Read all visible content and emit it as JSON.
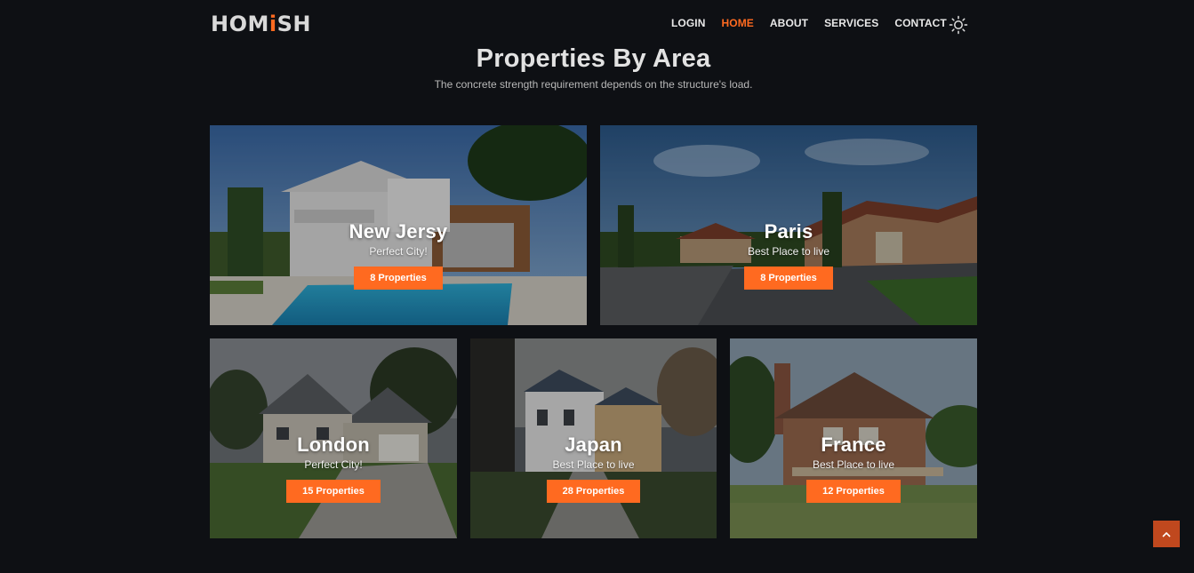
{
  "brand": {
    "logo_prefix": "HOM",
    "logo_accent": "i",
    "logo_suffix": "SH"
  },
  "nav": {
    "items": [
      {
        "label": "LOGIN",
        "active": false
      },
      {
        "label": "HOME",
        "active": true
      },
      {
        "label": "ABOUT",
        "active": false
      },
      {
        "label": "SERVICES",
        "active": false
      },
      {
        "label": "CONTACT",
        "active": false
      }
    ],
    "theme_toggle_icon": "sun-icon"
  },
  "section": {
    "title": "Properties By Area",
    "subtitle": "The concrete strength requirement depends on the structure's load."
  },
  "areas": [
    {
      "name": "New Jersy",
      "tagline": "Perfect City!",
      "button": "8 Properties"
    },
    {
      "name": "Paris",
      "tagline": "Best Place to live",
      "button": "8 Properties"
    },
    {
      "name": "London",
      "tagline": "Perfect City!",
      "button": "15 Properties"
    },
    {
      "name": "Japan",
      "tagline": "Best Place to live",
      "button": "28 Properties"
    },
    {
      "name": "France",
      "tagline": "Best Place to live",
      "button": "12 Properties"
    }
  ],
  "scroll_top_icon": "chevron-up-icon",
  "colors": {
    "accent": "#ff6a20",
    "background": "#0e1014",
    "scroll_top": "#c0481e"
  }
}
